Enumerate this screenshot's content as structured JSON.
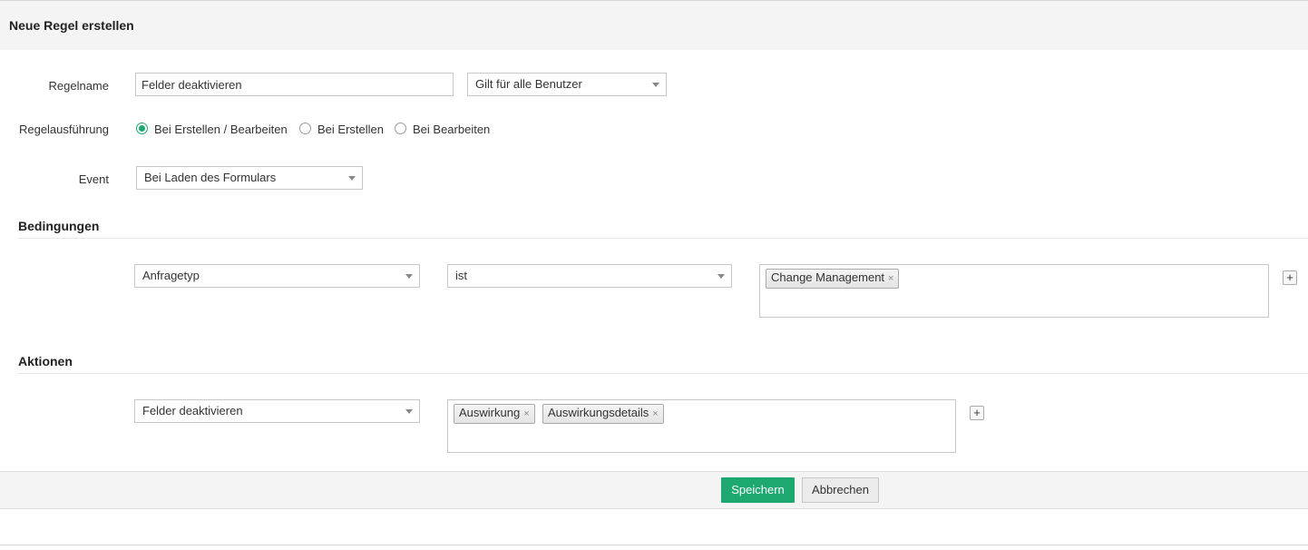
{
  "header": {
    "title": "Neue Regel erstellen"
  },
  "form": {
    "rule_name_label": "Regelname",
    "rule_name_value": "Felder deaktivieren",
    "applies_to_value": "Gilt für alle Benutzer",
    "execution_label": "Regelausführung",
    "execution_options": [
      {
        "label": "Bei Erstellen / Bearbeiten",
        "checked": true
      },
      {
        "label": "Bei Erstellen",
        "checked": false
      },
      {
        "label": "Bei Bearbeiten",
        "checked": false
      }
    ],
    "event_label": "Event",
    "event_value": "Bei Laden des Formulars"
  },
  "conditions": {
    "title": "Bedingungen",
    "field_value": "Anfragetyp",
    "operator_value": "ist",
    "values": [
      "Change Management"
    ],
    "add_label": "+"
  },
  "actions": {
    "title": "Aktionen",
    "action_value": "Felder deaktivieren",
    "fields": [
      "Auswirkung",
      "Auswirkungsdetails"
    ],
    "add_label": "+"
  },
  "footer": {
    "save_label": "Speichern",
    "cancel_label": "Abbrechen"
  },
  "colors": {
    "accent": "#1da86f",
    "header_bg": "#f4f4f4"
  },
  "tag_remove_glyph": "×"
}
